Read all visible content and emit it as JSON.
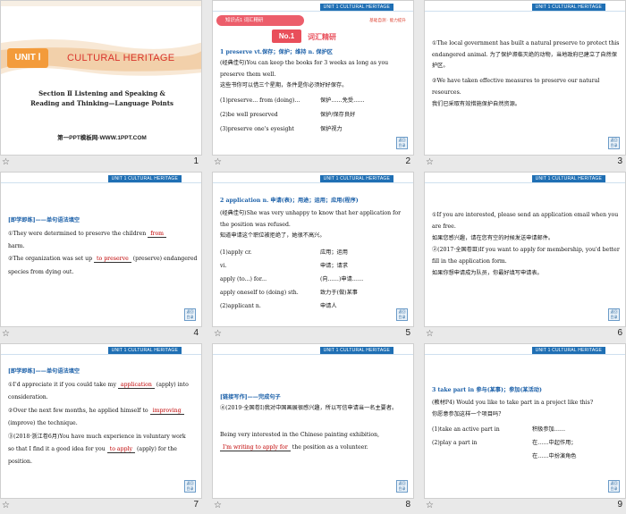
{
  "unit_tab": "UNIT 1   CULTURAL HERITAGE",
  "corner_btn": "返回 目录",
  "bar_star": "☆",
  "slide1": {
    "num": "1",
    "unit": "UNIT Ⅰ",
    "title": "CULTURAL HERITAGE",
    "section_line1": "Section Ⅱ   Listening and Speaking &",
    "section_line2": "Reading and Thinking—Language Points",
    "site": "第一PPT模板网-WWW.1PPT.COM"
  },
  "slide2": {
    "num": "2",
    "pill": "知识点1   词汇精研",
    "right": "基础自测 · 能力提升",
    "no1": "No.1",
    "vocab": "词汇精研",
    "item_head": "1  preserve  vt.保存；保护；维持  n. 保护区",
    "ex_a": "(经典佳句)You can keep the books for 3 weeks as long as you",
    "ex_b": "preserve them well.",
    "ex_cn": "这些书你可以借三个星期，条件是你必须好好保存。",
    "rows": [
      {
        "en": "(1)preserve... from (doing)...",
        "cn": "保护……免受……"
      },
      {
        "en": "(2)be well preserved",
        "cn": "保护/保存良好"
      },
      {
        "en": "(3)preserve one's eyesight",
        "cn": "保护视力"
      }
    ]
  },
  "slide3": {
    "num": "3",
    "p1": "①The local government has built a natural preserve to protect this endangered animal.    为了保护濒临灭绝的动物，当地政府已建立了自然保护区。",
    "p2": "②We have taken effective measures to preserve our natural resources.",
    "p2_cn": "我们已采取有效措施保护自然资源。"
  },
  "slide4": {
    "num": "4",
    "head": "[即学即练]——单句语法填空",
    "q1_a": "①They were determined to preserve the children",
    "q1_fill": "from",
    "q1_b": "harm.",
    "q2_a": "②The organization was set up",
    "q2_fill": "to preserve",
    "q2_b": "(preserve) endangered",
    "q2_c": "species from dying out."
  },
  "slide5": {
    "num": "5",
    "item_head": "2  application  n. 申请(表)；用途；运用；应用(程序)",
    "ex_a": "(经典佳句)She was very unhappy to know that her application for",
    "ex_b": "the position was refused.",
    "ex_cn": "知道申请这个职位被拒绝了，她很不高兴。",
    "rows": [
      {
        "en": "(1)apply cr.",
        "cn": "应用；运用"
      },
      {
        "en": "vi.",
        "cn": "申请；请求"
      },
      {
        "en": "apply (to...) for...",
        "cn": "(向……)申请……"
      },
      {
        "en": "apply oneself to (doing) sth.",
        "cn": "致力于(做)某事"
      },
      {
        "en": "(2)applicant n.",
        "cn": "申请人"
      }
    ]
  },
  "slide6": {
    "num": "6",
    "p1": "①If you are interested, please send an application email when you are free.",
    "p1_cn": "如果您感兴趣，请在您有空的时候发送申请邮件。",
    "p2": "②(2017·全国卷Ⅲ)If you want to apply for membership, you'd better fill in the application form.",
    "p2_cn": "如果你想申请成为队员，你最好填写申请表。"
  },
  "slide7": {
    "num": "7",
    "head": "[即学即练]——单句语法填空",
    "q1_a": "①I'd appreciate it if you could take my",
    "q1_fill": "application",
    "q1_b": "(apply) into",
    "q1_c": "consideration.",
    "q2_a": "②Over the next few months, he applied himself to",
    "q2_fill": "improving",
    "q2_b": "(improve) the technique.",
    "q3_a": "③(2018·浙江卷6月)You have much experience in voluntary work",
    "q3_b": "so that I find it a good idea for you",
    "q3_fill": "to apply",
    "q3_c": "(apply) for the",
    "q3_d": "position."
  },
  "slide8": {
    "num": "8",
    "head": "[链接写作]——完成句子",
    "p1": "④(2019·全国卷Ⅰ)我对中国画展很感兴趣，所以写信申请当一名主要者。",
    "p2_a": "Being very interested in the Chinese painting exhibition,",
    "p2_fill": "I'm writing to apply for",
    "p2_b": "the position as a volunteer."
  },
  "slide9": {
    "num": "9",
    "item_head": "3  take part in   参与(某事)；参加(某活动)",
    "ex_a": "(教材P4) Would you like to take part in a project like this?",
    "ex_cn": "你愿意参加这样一个项目吗？",
    "rows": [
      {
        "en": "(1)take an active part in",
        "cn": "积极参加……"
      },
      {
        "en": "(2)play a part in",
        "cn": "在……中起作用；"
      },
      {
        "en": "",
        "cn": "在……中扮演角色"
      }
    ]
  }
}
